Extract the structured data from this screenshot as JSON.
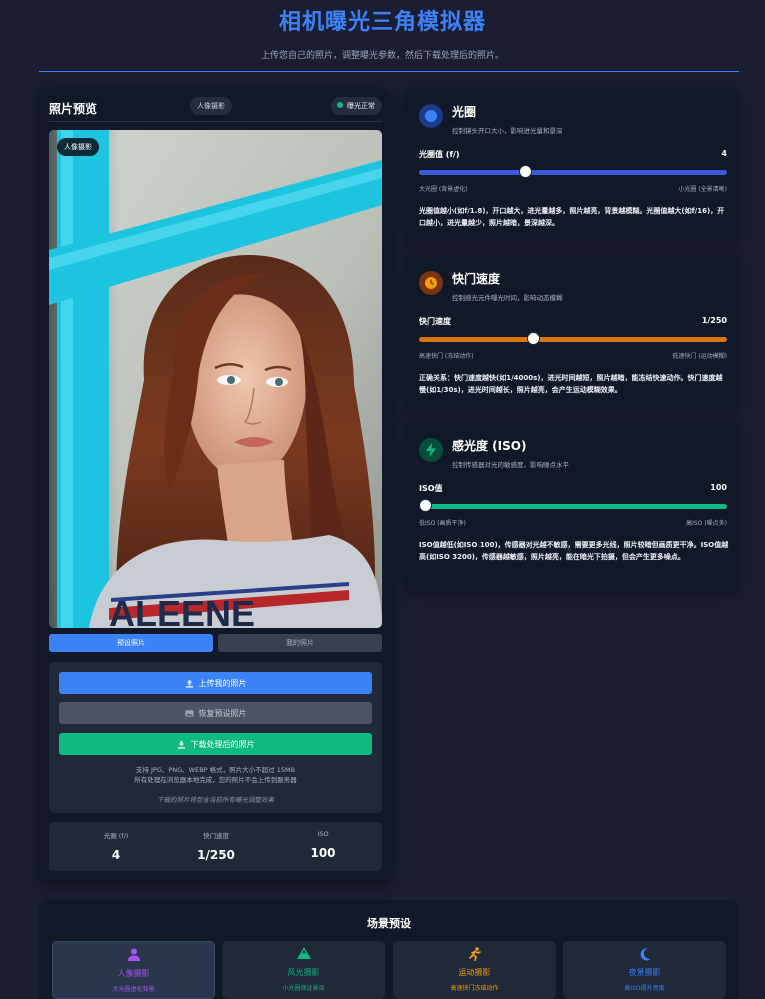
{
  "header": {
    "title": "相机曝光三角模拟器",
    "subtitle": "上传您自己的照片，调整曝光参数，然后下载处理后的照片。"
  },
  "preview": {
    "title": "照片预览",
    "scene_tag": "人像摄影",
    "status": "曝光正常",
    "photo_badge": "人像摄影",
    "photo_shirt_text": "ALEENE",
    "toggle_preset": "预设照片",
    "toggle_mine": "我的照片"
  },
  "upload": {
    "upload_btn": "上传我的照片",
    "restore_btn": "恢复预设照片",
    "download_btn": "下载处理后的照片",
    "note_line1": "支持 JPG、PNG、WEBP 格式，照片大小不超过 15MB",
    "note_line2": "所有处理在浏览器本地完成，您的照片不会上传到服务器",
    "italic_note": "下载的照片将包含当前所有曝光调整效果"
  },
  "stats": [
    {
      "label": "光圈 (f/)",
      "value": "4"
    },
    {
      "label": "快门速度",
      "value": "1/250"
    },
    {
      "label": "ISO",
      "value": "100"
    }
  ],
  "aperture": {
    "title": "光圈",
    "subtitle": "控制镜头开口大小，影响进光量和景深",
    "label": "光圈值 (f/)",
    "value": "4",
    "slider_fraction": 0.34,
    "min_label": "大光圈 (背景虚化)",
    "max_label": "小光圈 (全景清晰)",
    "desc": "光圈值越小(如f/1.8)，开口越大，进光量越多，照片越亮，背景越模糊。光圈值越大(如f/16)，开口越小，进光量越少，照片越暗，景深越深。"
  },
  "shutter": {
    "title": "快门速度",
    "subtitle": "控制感光元件曝光时间，影响动态模糊",
    "label": "快门速度",
    "value": "1/250",
    "slider_fraction": 0.365,
    "min_label": "高速快门 (冻结动作)",
    "max_label": "低速快门 (运动模糊)",
    "desc": "正确关系：快门速度越快(如1/4000s)，进光时间越短，照片越暗，能冻结快速动作。快门速度越慢(如1/30s)，进光时间越长，照片越亮，会产生运动模糊效果。"
  },
  "iso": {
    "title": "感光度 (ISO)",
    "subtitle": "控制传感器对光的敏感度，影响噪点水平",
    "label": "ISO值",
    "value": "100",
    "slider_fraction": 0.0,
    "min_label": "低ISO (画质干净)",
    "max_label": "高ISO (噪点多)",
    "desc": "ISO值越低(如ISO 100)，传感器对光越不敏感，需要更多光线，照片较暗但画质更干净。ISO值越高(如ISO 3200)，传感器越敏感，照片越亮，能在暗光下拍摄，但会产生更多噪点。"
  },
  "scenes": {
    "title": "场景预设",
    "items": [
      {
        "name": "人像摄影",
        "desc": "大光圈虚化背景",
        "color": "#a855f7",
        "icon": "person-icon"
      },
      {
        "name": "风光摄影",
        "desc": "小光圈保证景深",
        "color": "#10b981",
        "icon": "mountain-icon"
      },
      {
        "name": "运动摄影",
        "desc": "高速快门冻结动作",
        "color": "#f59e0b",
        "icon": "running-icon"
      },
      {
        "name": "夜景摄影",
        "desc": "高ISO提升亮度",
        "color": "#3b82f6",
        "icon": "moon-icon"
      }
    ]
  },
  "colors": {
    "accent": "#3b82f6",
    "success": "#10b981",
    "aperture_track": "#3b5bdb",
    "shutter_track": "#d97706",
    "iso_track": "#10b981"
  }
}
